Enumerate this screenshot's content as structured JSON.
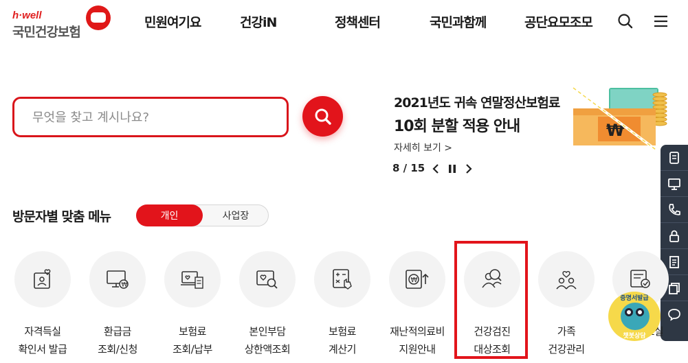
{
  "header": {
    "brand_small": "h·well",
    "brand_name": "국민건강보험",
    "nav": [
      "민원여기요",
      "건강iN",
      "정책센터",
      "국민과함께",
      "공단요모조모"
    ],
    "search_icon": "search-icon",
    "menu_icon": "hamburger-icon"
  },
  "search": {
    "placeholder": "무엇을 찾고 계시나요?",
    "button_icon": "search-icon"
  },
  "banner": {
    "title_line1": "2021년도 귀속 연말정산보험료",
    "title_line2": "10회 분할 적용 안내",
    "more": "자세히 보기 >",
    "page": "8 / 15",
    "prev_icon": "chevron-left-icon",
    "pause_icon": "pause-icon",
    "next_icon": "chevron-right-icon"
  },
  "quick_menu": {
    "icons": [
      "receipt-icon",
      "monitor-icon",
      "phone-icon",
      "lock-icon",
      "document-icon",
      "copy-icon",
      "chat-icon"
    ]
  },
  "menu": {
    "title": "방문자별 맞춤 메뉴",
    "tabs": [
      "개인",
      "사업장"
    ],
    "active_tab": "개인",
    "items": [
      {
        "line1": "자격득실",
        "line2": "확인서 발급",
        "icon": "id-card-heart-icon"
      },
      {
        "line1": "환급금",
        "line2": "조회/신청",
        "icon": "monitor-won-icon"
      },
      {
        "line1": "보험료",
        "line2": "조회/납부",
        "icon": "bill-laptop-icon"
      },
      {
        "line1": "본인부담",
        "line2": "상한액조회",
        "icon": "heart-search-icon"
      },
      {
        "line1": "보험료",
        "line2": "계산기",
        "icon": "calculator-icon"
      },
      {
        "line1": "재난적의료비",
        "line2": "지원안내",
        "icon": "won-support-icon"
      },
      {
        "line1": "건강검진",
        "line2": "대상조회",
        "icon": "people-search-icon"
      },
      {
        "line1": "가족",
        "line2": "건강관리",
        "icon": "family-heart-icon"
      },
      {
        "line1": "서식자료실",
        "line2": "",
        "icon": "form-check-icon"
      }
    ]
  },
  "chatbot": {
    "top_text": "증명서발급",
    "bottom_text": "챗봇상담"
  },
  "colors": {
    "accent": "#e2141b",
    "sidebar": "#2e3744",
    "circle_bg": "#f3f3f3"
  }
}
